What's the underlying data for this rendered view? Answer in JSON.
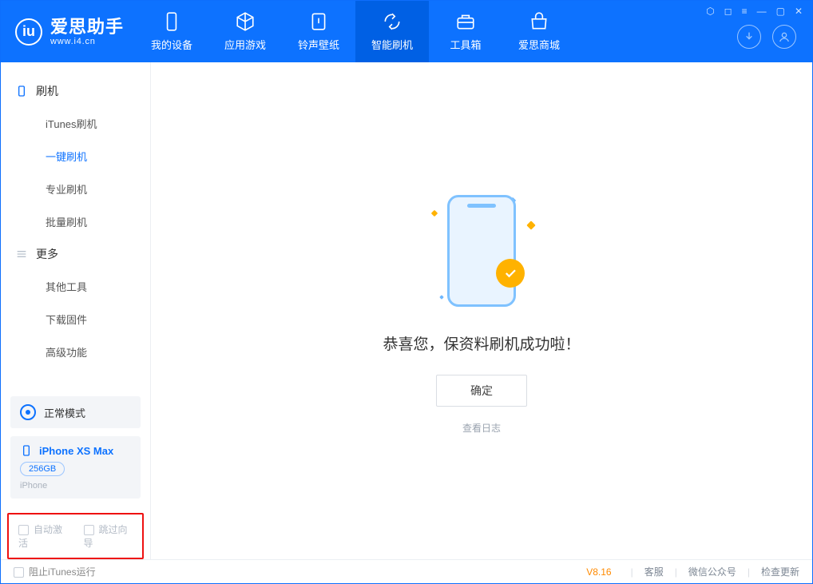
{
  "app": {
    "title": "爱思助手",
    "site": "www.i4.cn"
  },
  "nav": {
    "items": [
      {
        "label": "我的设备",
        "icon": "device-icon"
      },
      {
        "label": "应用游戏",
        "icon": "cube-icon"
      },
      {
        "label": "铃声壁纸",
        "icon": "music-icon"
      },
      {
        "label": "智能刷机",
        "icon": "refresh-icon"
      },
      {
        "label": "工具箱",
        "icon": "toolbox-icon"
      },
      {
        "label": "爱思商城",
        "icon": "store-icon"
      }
    ],
    "active_index": 3
  },
  "sidebar": {
    "group1": {
      "title": "刷机",
      "items": [
        {
          "label": "iTunes刷机"
        },
        {
          "label": "一键刷机"
        },
        {
          "label": "专业刷机"
        },
        {
          "label": "批量刷机"
        }
      ],
      "active_index": 1
    },
    "group2": {
      "title": "更多",
      "items": [
        {
          "label": "其他工具"
        },
        {
          "label": "下载固件"
        },
        {
          "label": "高级功能"
        }
      ]
    },
    "mode": "正常模式",
    "device": {
      "name": "iPhone XS Max",
      "capacity": "256GB",
      "type": "iPhone"
    },
    "checks": {
      "auto_activate": "自动激活",
      "skip_guide": "跳过向导"
    }
  },
  "main": {
    "success_text": "恭喜您，保资料刷机成功啦！",
    "ok_button": "确定",
    "view_log": "查看日志"
  },
  "footer": {
    "block_itunes": "阻止iTunes运行",
    "version": "V8.16",
    "links": [
      "客服",
      "微信公众号",
      "检查更新"
    ]
  }
}
